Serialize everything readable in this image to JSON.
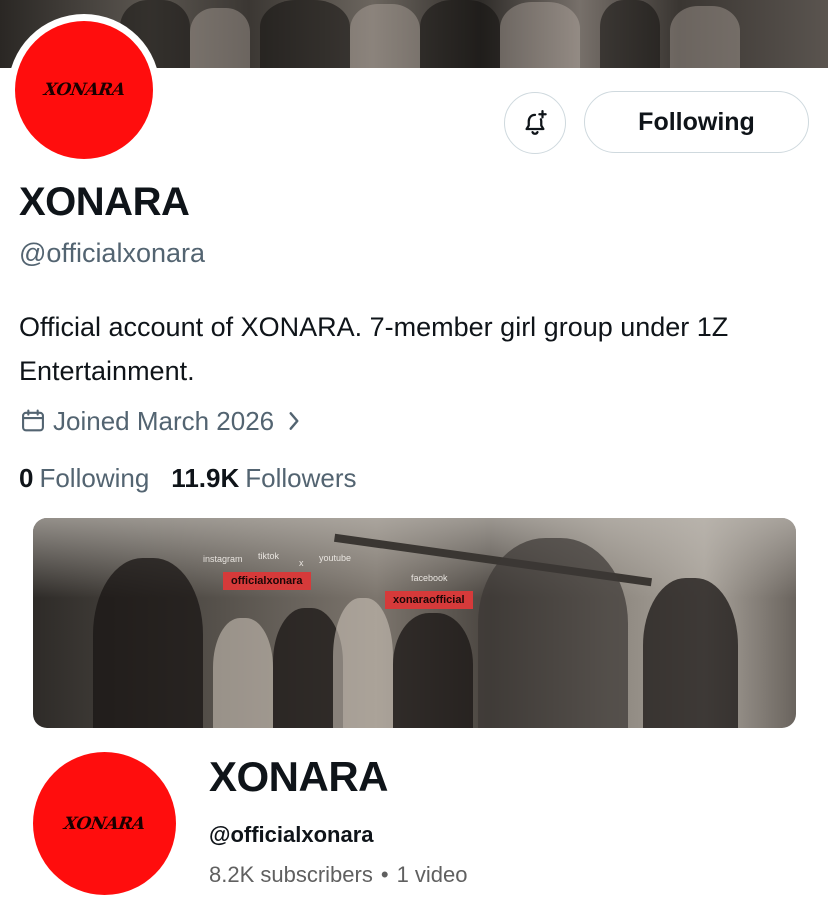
{
  "profile": {
    "avatar_logo_text": "XONARA",
    "display_name": "XONARA",
    "handle": "@officialxonara",
    "bio": "Official account of XONARA. 7-member girl group under 1Z Entertainment.",
    "joined": "Joined March 2026",
    "following_count": "0",
    "following_label": "Following",
    "followers_count": "11.9K",
    "followers_label": "Followers"
  },
  "actions": {
    "notify_icon": "bell-plus-icon",
    "following_button": "Following"
  },
  "card": {
    "banner_texts": {
      "instagram": "instagram",
      "tiktok": "tiktok",
      "x": "x",
      "youtube": "youtube",
      "facebook": "facebook",
      "tag1": "officialxonara",
      "tag2": "xonaraofficial"
    },
    "logo_text": "XONARA",
    "channel_name": "XONARA",
    "channel_handle": "@officialxonara",
    "subscribers": "8.2K subscribers",
    "videos": "1 video",
    "separator": "•"
  },
  "colors": {
    "brand_red": "#ff0d0d",
    "text_primary": "#0f1419",
    "text_secondary": "#536471",
    "border": "#cfd9de"
  }
}
